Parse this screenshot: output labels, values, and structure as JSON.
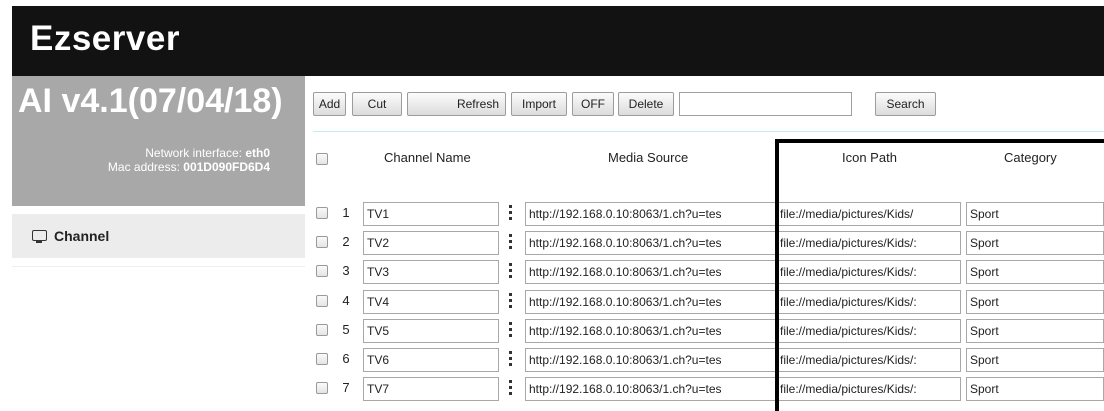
{
  "app": {
    "title": "Ezserver"
  },
  "sidebar": {
    "version": "AI v4.1(07/04/18)",
    "network_label": "Network interface:",
    "network_value": "eth0",
    "mac_label": "Mac address:",
    "mac_value": "001D090FD6D4",
    "items": [
      {
        "label": "Channel",
        "icon": "monitor-icon"
      }
    ]
  },
  "toolbar": {
    "add": "Add",
    "cut": "Cut",
    "refresh": "Refresh",
    "import": "Import",
    "off": "OFF",
    "delete": "Delete",
    "search_value": "",
    "search": "Search"
  },
  "table": {
    "columns": [
      "Channel Name",
      "Media Source",
      "Icon Path",
      "Category"
    ],
    "rows": [
      {
        "num": "1",
        "name": "TV1",
        "source": "http://192.168.0.10:8063/1.ch?u=tes",
        "icon": "file://media/pictures/Kids/",
        "category": "Sport"
      },
      {
        "num": "2",
        "name": "TV2",
        "source": "http://192.168.0.10:8063/1.ch?u=tes",
        "icon": "file://media/pictures/Kids/:",
        "category": "Sport"
      },
      {
        "num": "3",
        "name": "TV3",
        "source": "http://192.168.0.10:8063/1.ch?u=tes",
        "icon": "file://media/pictures/Kids/:",
        "category": "Sport"
      },
      {
        "num": "4",
        "name": "TV4",
        "source": "http://192.168.0.10:8063/1.ch?u=tes",
        "icon": "file://media/pictures/Kids/:",
        "category": "Sport"
      },
      {
        "num": "5",
        "name": "TV5",
        "source": "http://192.168.0.10:8063/1.ch?u=tes",
        "icon": "file://media/pictures/Kids/:",
        "category": "Sport"
      },
      {
        "num": "6",
        "name": "TV6",
        "source": "http://192.168.0.10:8063/1.ch?u=tes",
        "icon": "file://media/pictures/Kids/:",
        "category": "Sport"
      },
      {
        "num": "7",
        "name": "TV7",
        "source": "http://192.168.0.10:8063/1.ch?u=tes",
        "icon": "file://media/pictures/Kids/:",
        "category": "Sport"
      }
    ]
  },
  "colors": {
    "header": "#121212",
    "sidebar_top": "#a8a8a8",
    "sidebar_item": "#ececec",
    "divider": "#c8ecec"
  }
}
